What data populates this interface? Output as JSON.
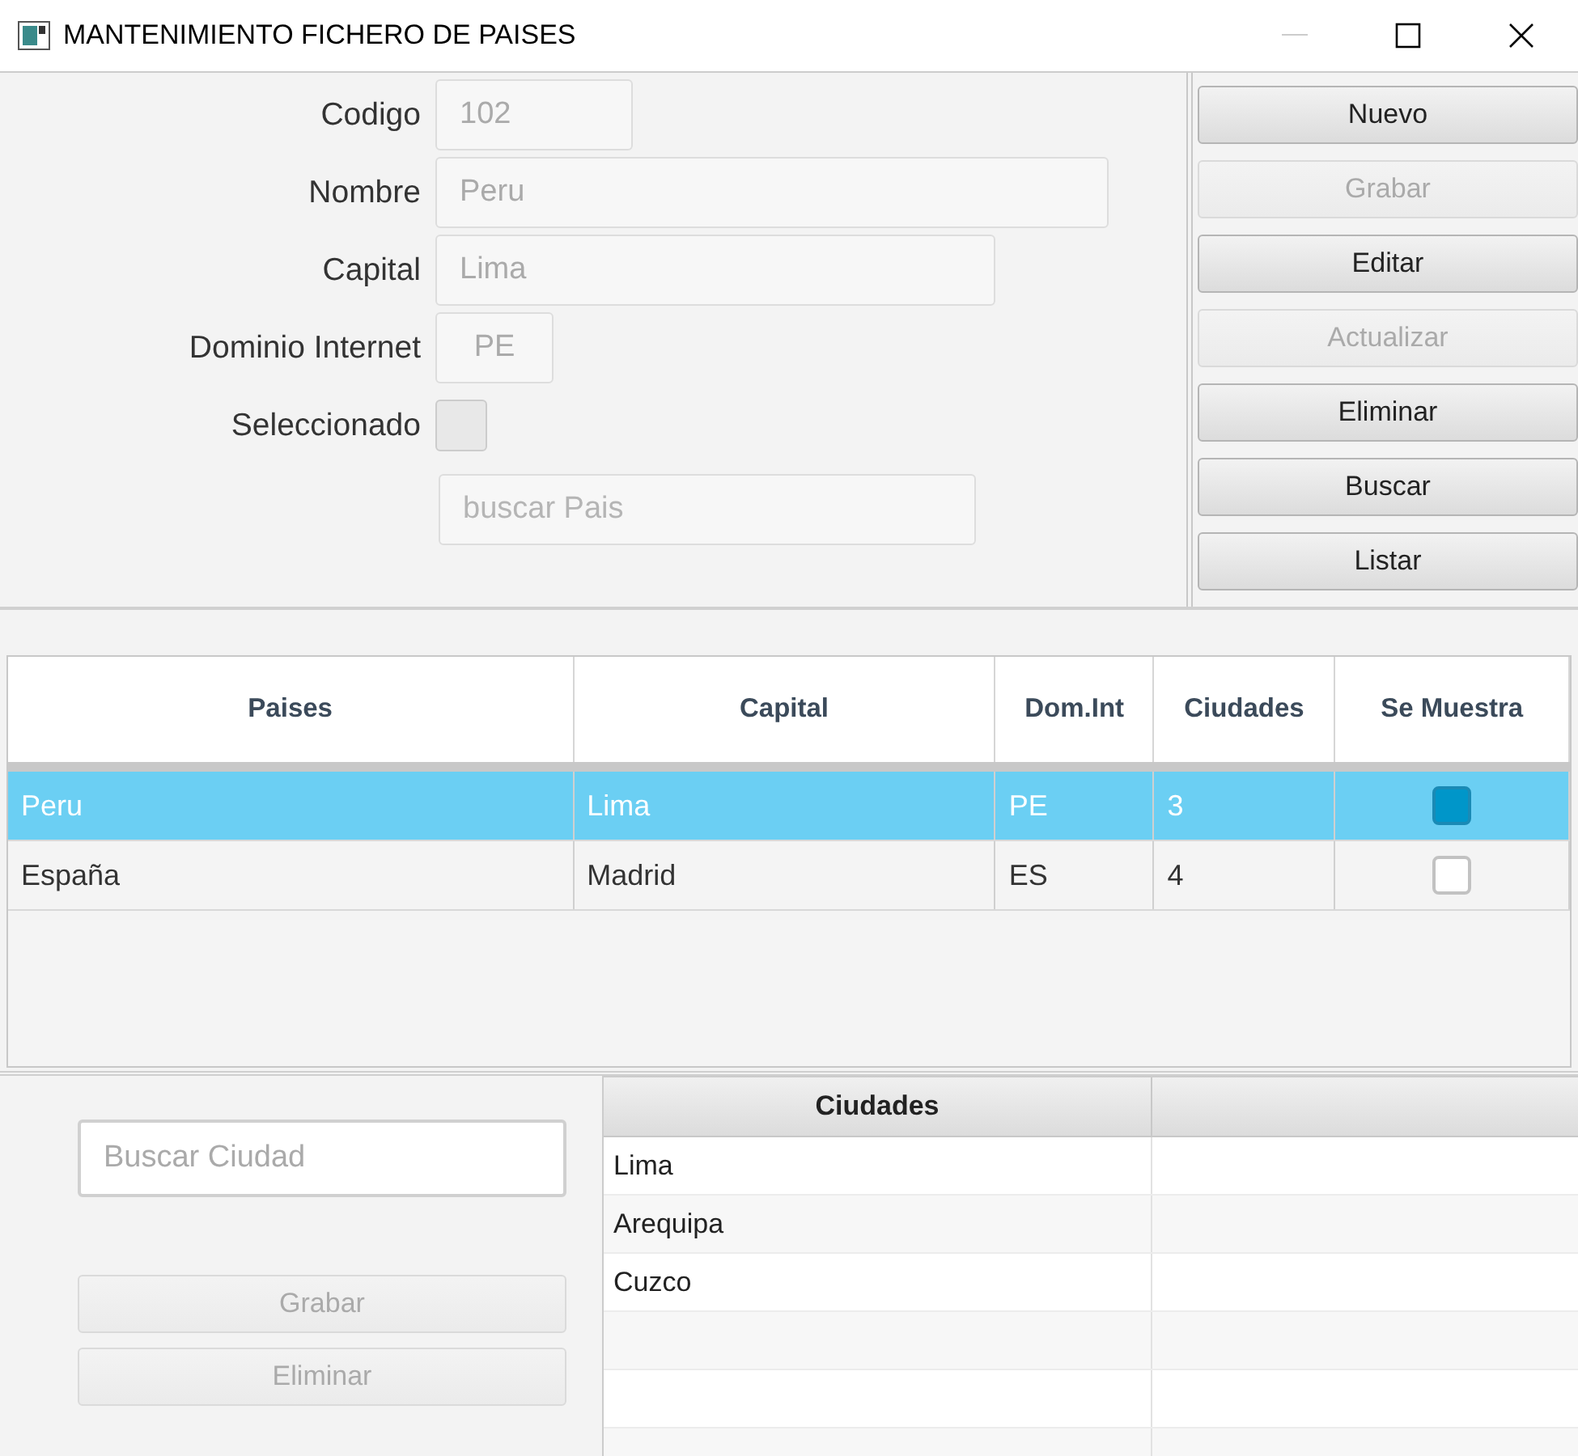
{
  "window": {
    "title": "MANTENIMIENTO FICHERO DE PAISES",
    "minimize_disabled": true
  },
  "form": {
    "fields": [
      {
        "kind": "text",
        "label": "Codigo",
        "value": "102",
        "disabled": true
      },
      {
        "kind": "text",
        "label": "Nombre",
        "value": "Peru",
        "disabled": true
      },
      {
        "kind": "text",
        "label": "Capital",
        "value": "Lima",
        "disabled": true
      },
      {
        "kind": "text",
        "label": "Dominio Internet",
        "value": "PE",
        "disabled": true
      },
      {
        "kind": "checkbox",
        "label": "Seleccionado",
        "checked": false,
        "disabled": true
      },
      {
        "kind": "search",
        "placeholder": "buscar Pais",
        "disabled": true
      }
    ]
  },
  "actions": [
    {
      "label": "Nuevo",
      "disabled": false
    },
    {
      "label": "Grabar",
      "disabled": true
    },
    {
      "label": "Editar",
      "disabled": false
    },
    {
      "label": "Actualizar",
      "disabled": true
    },
    {
      "label": "Eliminar",
      "disabled": false
    },
    {
      "label": "Buscar",
      "disabled": false
    },
    {
      "label": "Listar",
      "disabled": false
    }
  ],
  "table": {
    "columns": [
      "Paises",
      "Capital",
      "Dom.Int",
      "Ciudades",
      "Se Muestra"
    ],
    "rows": [
      {
        "selected": true,
        "cells": [
          "Peru",
          "Lima",
          "PE",
          "3"
        ],
        "shown": true
      },
      {
        "selected": false,
        "cells": [
          "España",
          "Madrid",
          "ES",
          "4"
        ],
        "shown": false
      }
    ]
  },
  "cities": {
    "search": {
      "placeholder": "Buscar Ciudad"
    },
    "buttons": [
      {
        "label": "Grabar",
        "disabled": true
      },
      {
        "label": "Eliminar",
        "disabled": true
      }
    ],
    "columns": [
      "Ciudades"
    ],
    "rows": [
      "Lima",
      "Arequipa",
      "Cuzco"
    ]
  }
}
